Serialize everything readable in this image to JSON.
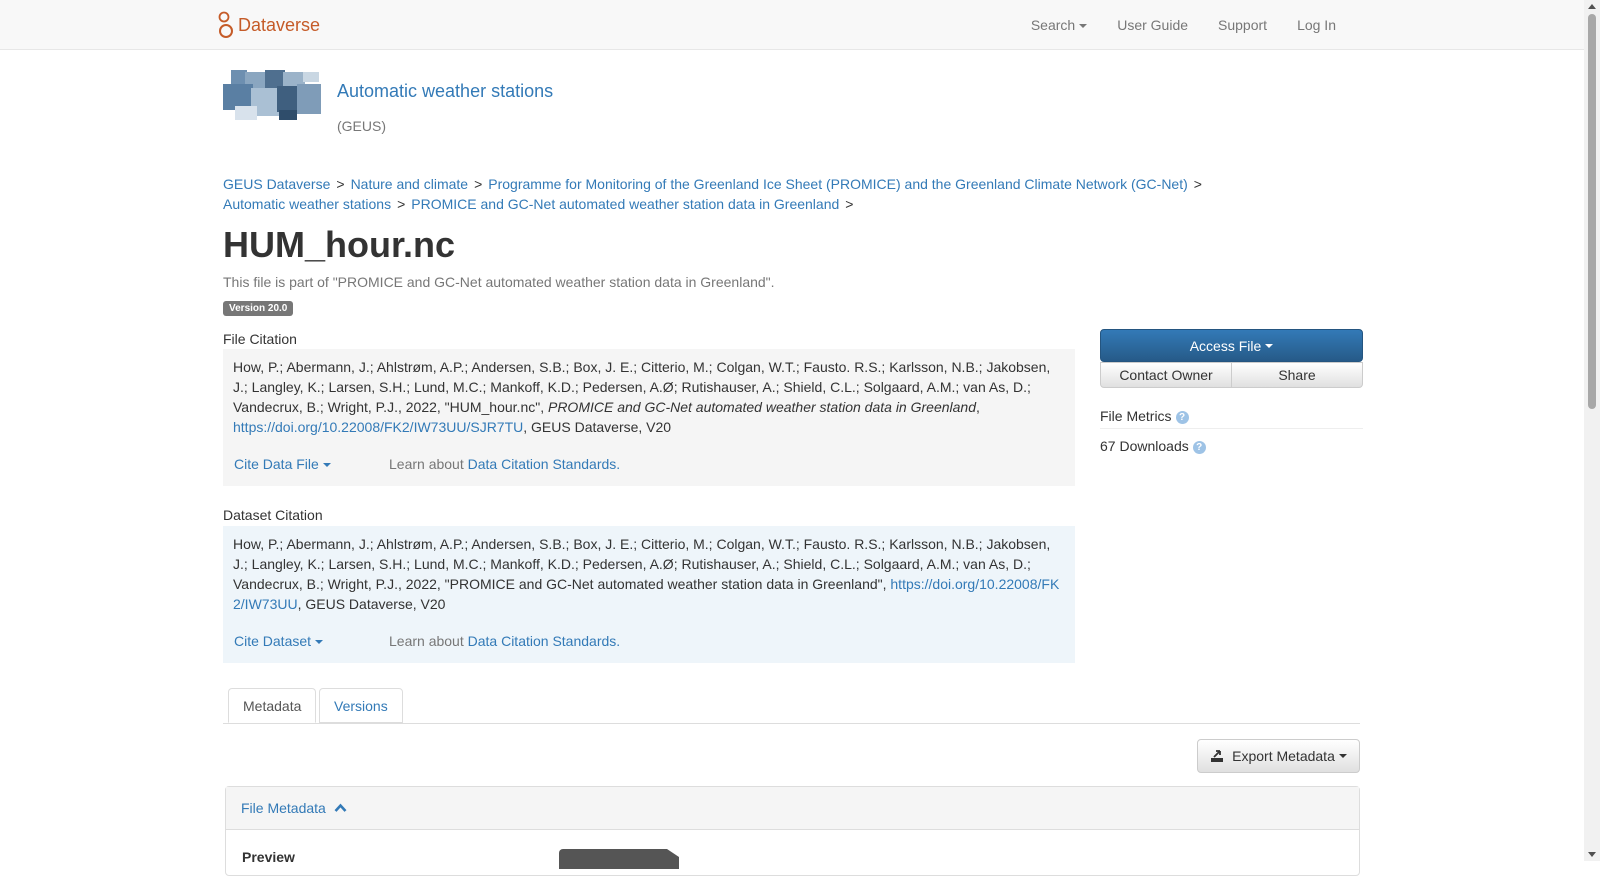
{
  "navbar": {
    "brand": "Dataverse",
    "items": [
      {
        "label": "Search",
        "dropdown": true
      },
      {
        "label": "User Guide",
        "dropdown": false
      },
      {
        "label": "Support",
        "dropdown": false
      },
      {
        "label": "Log In",
        "dropdown": false
      }
    ]
  },
  "dataverse": {
    "title": "Automatic weather stations",
    "affiliation": "(GEUS)"
  },
  "breadcrumb": [
    "GEUS Dataverse",
    "Nature and climate",
    "Programme for Monitoring of the Greenland Ice Sheet (PROMICE) and the Greenland Climate Network (GC-Net)",
    "Automatic weather stations",
    "PROMICE and GC-Net automated weather station data in Greenland"
  ],
  "breadcrumb_sep": ">",
  "file": {
    "title": "HUM_hour.nc",
    "part_of": "This file is part of \"PROMICE and GC-Net automated weather station data in Greenland\".",
    "version": "Version 20.0"
  },
  "file_citation": {
    "label": "File Citation",
    "text_pre": "How, P.; Abermann, J.; Ahlstrøm, A.P.; Andersen, S.B.; Box, J. E.; Citterio, M.; Colgan, W.T.; Fausto. R.S.; Karlsson, N.B.; Jakobsen, J.; Langley, K.; Larsen, S.H.; Lund, M.C.; Mankoff, K.D.; Pedersen, A.Ø; Rutishauser, A.; Shield, C.L.; Solgaard, A.M.; van As, D.; Vandecrux, B.; Wright, P.J., 2022, \"HUM_hour.nc\", ",
    "text_italic": "PROMICE and GC-Net automated weather station data in Greenland",
    "text_comma": ",",
    "doi": "https://doi.org/10.22008/FK2/IW73UU/SJR7TU",
    "text_post": ", GEUS Dataverse, V20",
    "cite_button": "Cite Data File",
    "learn_prefix": "Learn about",
    "learn_link": "Data Citation Standards."
  },
  "dataset_citation": {
    "label": "Dataset Citation",
    "text_pre": "How, P.; Abermann, J.; Ahlstrøm, A.P.; Andersen, S.B.; Box, J. E.; Citterio, M.; Colgan, W.T.; Fausto. R.S.; Karlsson, N.B.; Jakobsen, J.; Langley, K.; Larsen, S.H.; Lund, M.C.; Mankoff, K.D.; Pedersen, A.Ø; Rutishauser, A.; Shield, C.L.; Solgaard, A.M.; van As, D.; Vandecrux, B.; Wright, P.J., 2022, \"PROMICE and GC-Net automated weather station data in Greenland\", ",
    "doi": "https://doi.org/10.22008/FK2/IW73UU",
    "text_post": ", GEUS Dataverse, V20",
    "cite_button": "Cite Dataset",
    "learn_prefix": "Learn about",
    "learn_link": "Data Citation Standards."
  },
  "actions": {
    "access_file": "Access File",
    "contact_owner": "Contact Owner",
    "share": "Share"
  },
  "metrics": {
    "title": "File Metrics",
    "downloads": "67 Downloads",
    "help_glyph": "?"
  },
  "tabs": [
    {
      "label": "Metadata",
      "active": true
    },
    {
      "label": "Versions",
      "active": false
    }
  ],
  "export_metadata": "Export Metadata",
  "file_metadata_panel": {
    "title": "File Metadata",
    "preview_label": "Preview"
  },
  "colors": {
    "brand": "#c55b28",
    "link": "#337ab7",
    "primary_button": "#337ab7"
  }
}
